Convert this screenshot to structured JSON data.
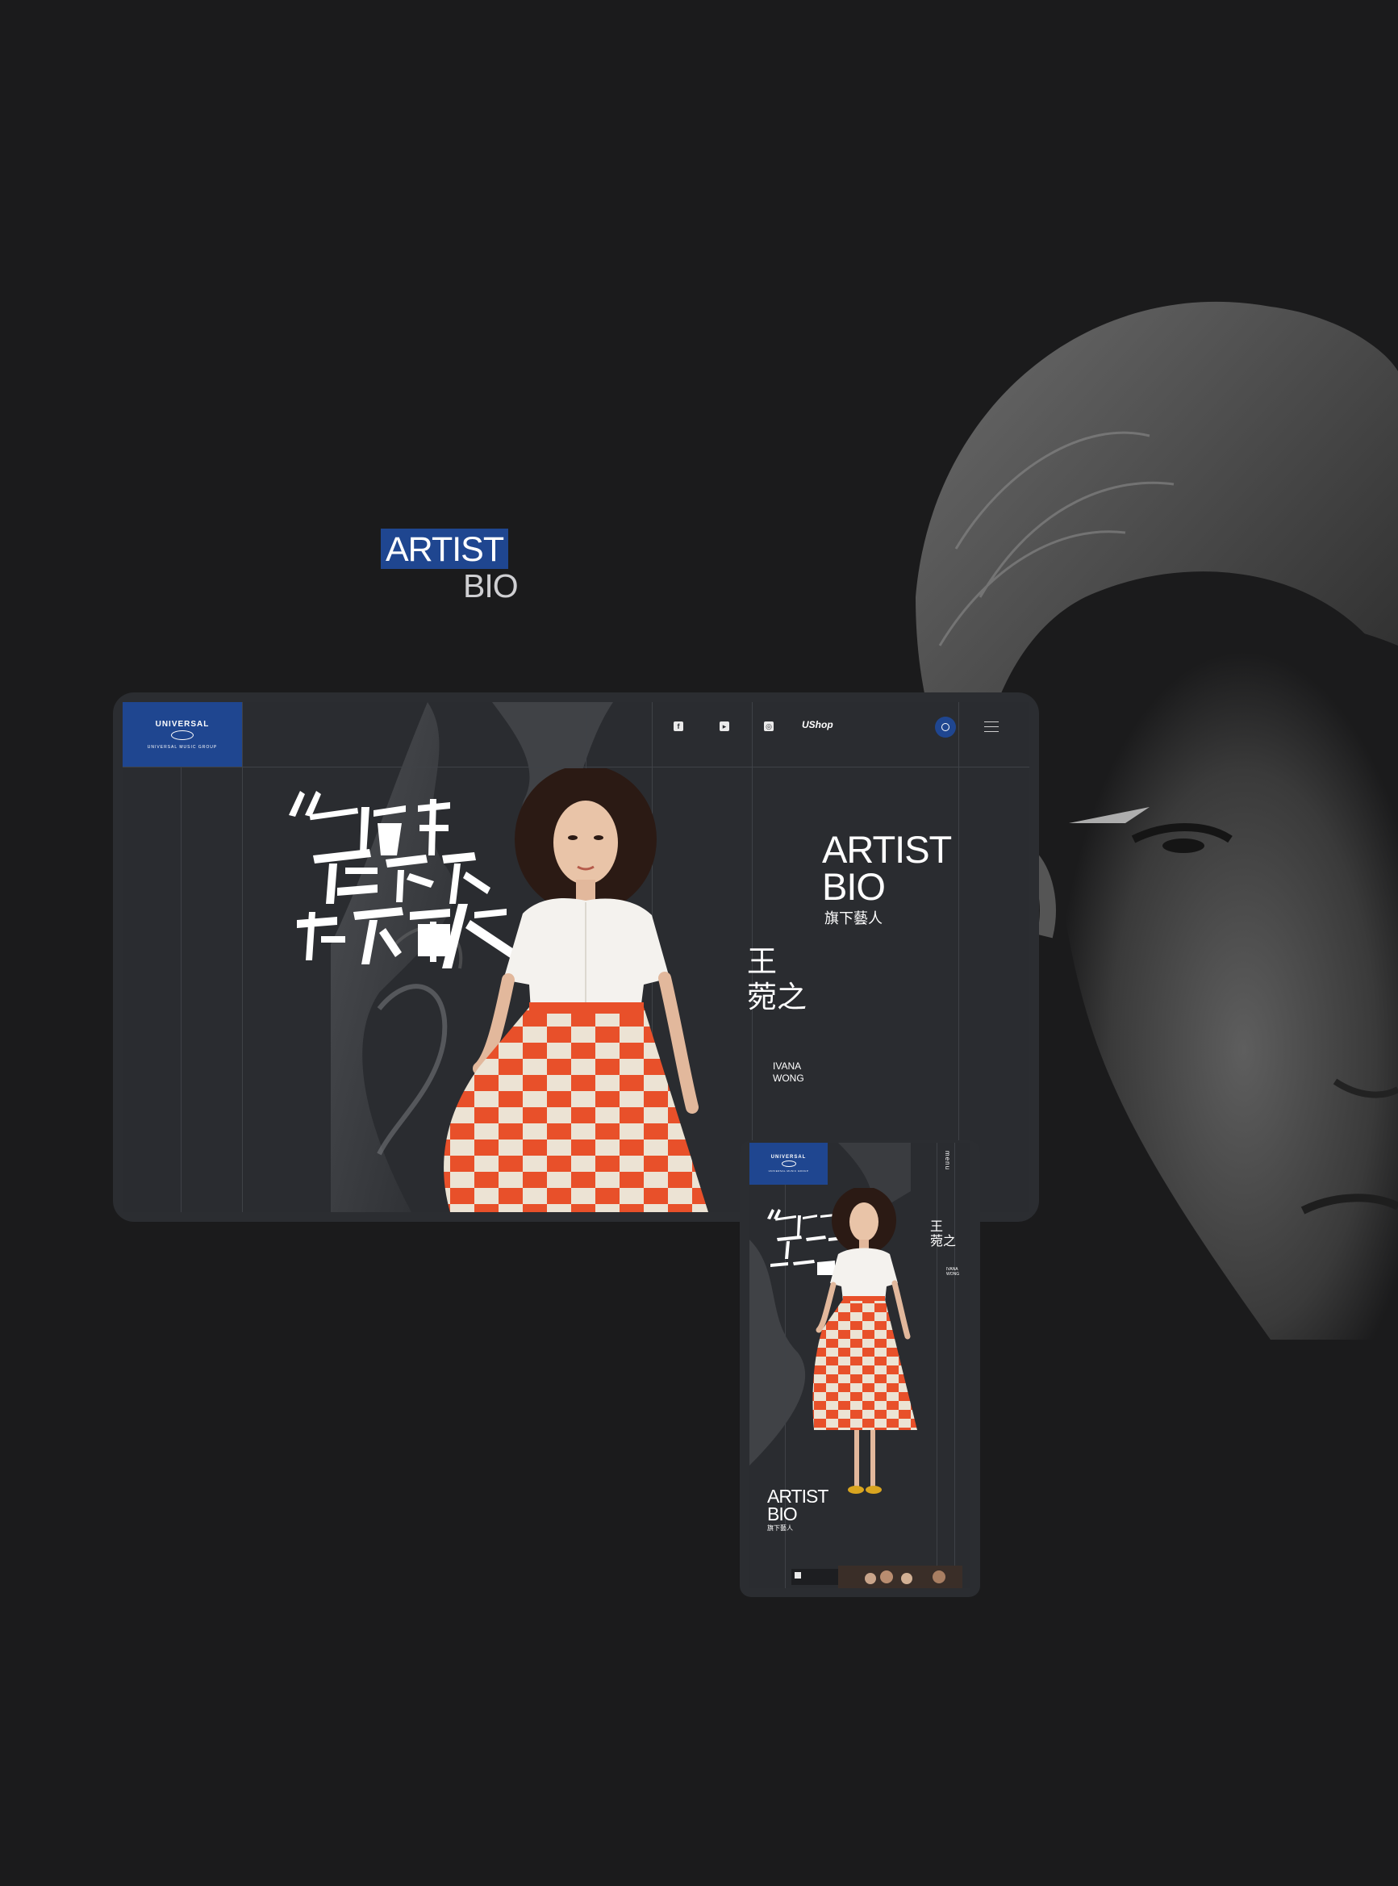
{
  "hero": {
    "title_line1": "ARTIST",
    "title_line2": "BIO"
  },
  "desktop": {
    "logo": {
      "brand": "UNIVERSAL",
      "sub": "UNIVERSAL MUSIC GROUP"
    },
    "nav": {
      "social_icons": [
        "facebook-icon",
        "youtube-icon",
        "instagram-icon"
      ],
      "shop_label": "UShop"
    },
    "section_title_line1": "ARTIST",
    "section_title_line2": "BIO",
    "section_subtitle": "旗下藝人",
    "artist_name_zh_line1": "王",
    "artist_name_zh_line2": "菀之",
    "artist_name_en_line1": "IVANA",
    "artist_name_en_line2": "WONG",
    "calligraphy_text": "一位有藝術感的女唱作人"
  },
  "mobile": {
    "logo": {
      "brand": "UNIVERSAL",
      "sub": "UNIVERSAL MUSIC GROUP"
    },
    "menu_label": "menu",
    "artist_name_zh_line1": "王",
    "artist_name_zh_line2": "菀之",
    "artist_name_en_line1": "IVANA",
    "artist_name_en_line2": "WONG",
    "section_title_line1": "ARTIST",
    "section_title_line2": "BIO",
    "section_subtitle": "旗下藝人"
  },
  "colors": {
    "background": "#1b1b1c",
    "accent": "#1f4690",
    "skirt_orange": "#e8502a",
    "skirt_cream": "#ece3d4"
  }
}
